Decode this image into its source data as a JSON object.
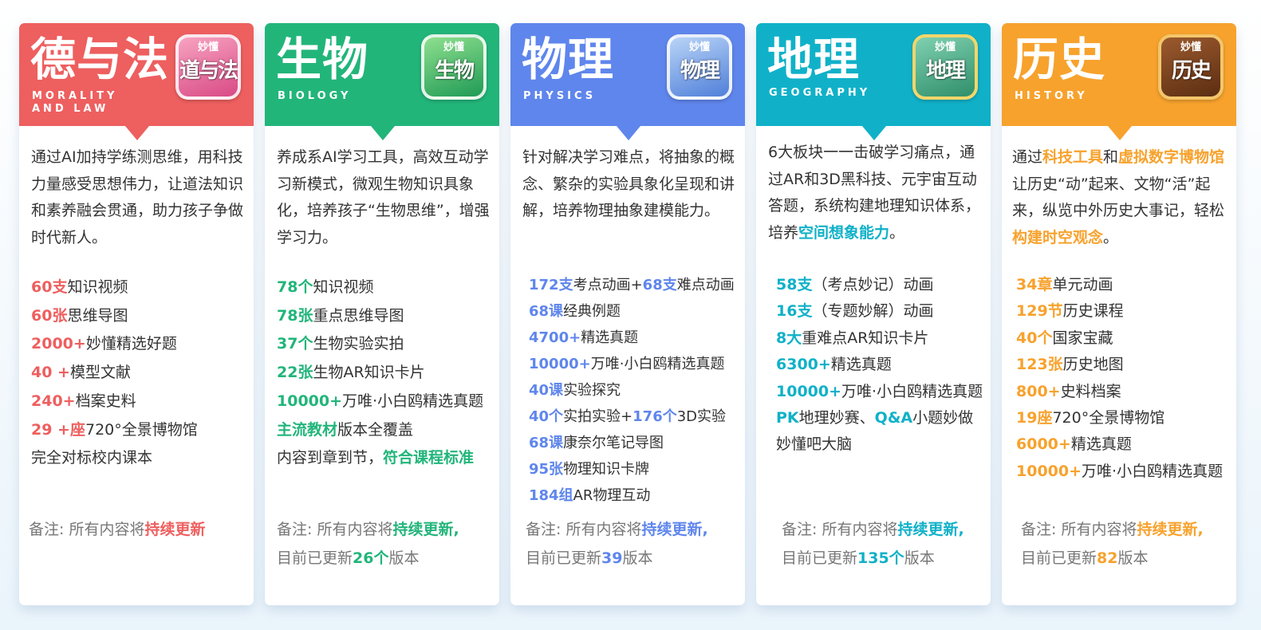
{
  "cards": [
    {
      "title": "德与法",
      "english_line1": "MORALITY",
      "english_line2": "AND LAW",
      "badge_brand": "妙懂",
      "badge_text": "道与法",
      "color": "#ee5f5f",
      "desc": [
        {
          "t": "通过AI加持学练测思维，用科技力量感受思想伟力，让道法知识和素养融会贯通，助力孩子争做时代新人。"
        }
      ],
      "items": [
        [
          {
            "t": "60支",
            "h": true
          },
          {
            "t": "知识视频"
          }
        ],
        [
          {
            "t": "60张",
            "h": true
          },
          {
            "t": "思维导图"
          }
        ],
        [
          {
            "t": "2000+",
            "h": true
          },
          {
            "t": "妙懂精选好题"
          }
        ],
        [
          {
            "t": "40 +",
            "h": true
          },
          {
            "t": "模型文献"
          }
        ],
        [
          {
            "t": "240+",
            "h": true
          },
          {
            "t": "档案史料"
          }
        ],
        [
          {
            "t": "29 +座",
            "h": true
          },
          {
            "t": "720°全景博物馆"
          }
        ],
        [
          {
            "t": "完全对标校内课本"
          }
        ]
      ],
      "note_line1": [
        {
          "t": "备注: 所有内容将"
        },
        {
          "t": "持续更新",
          "h": true
        }
      ],
      "note_line2": []
    },
    {
      "title": "生物",
      "english_line1": "BIOLOGY",
      "english_line2": "",
      "badge_brand": "妙懂",
      "badge_text": "生物",
      "color": "#22b57a",
      "desc": [
        {
          "t": "养成系AI学习工具，高效互动学习新模式，微观生物知识具象化，培养孩子“生物思维”，增强学习力。"
        }
      ],
      "items": [
        [
          {
            "t": "78个",
            "h": true
          },
          {
            "t": "知识视频"
          }
        ],
        [
          {
            "t": "78张",
            "h": true
          },
          {
            "t": "重点思维导图"
          }
        ],
        [
          {
            "t": "37个",
            "h": true
          },
          {
            "t": "生物实验实拍"
          }
        ],
        [
          {
            "t": "22张",
            "h": true
          },
          {
            "t": "生物AR知识卡片"
          }
        ],
        [
          {
            "t": "10000+",
            "h": true
          },
          {
            "t": "万唯·小白鸥精选真题"
          }
        ],
        [
          {
            "t": "主流教材",
            "h": true
          },
          {
            "t": "版本全覆盖"
          }
        ],
        [
          {
            "t": "内容到章到节，"
          },
          {
            "t": "符合课程标准",
            "h": true
          }
        ]
      ],
      "note_line1": [
        {
          "t": "备注: 所有内容将"
        },
        {
          "t": "持续更新,",
          "h": true
        }
      ],
      "note_line2": [
        {
          "t": "目前已更新"
        },
        {
          "t": "26个",
          "h": true
        },
        {
          "t": "版本"
        }
      ]
    },
    {
      "title": "物理",
      "english_line1": "PHYSICS",
      "english_line2": "",
      "badge_brand": "妙懂",
      "badge_text": "物理",
      "color": "#5f86ec",
      "desc": [
        {
          "t": "针对解决学习难点，将抽象的概念、繁杂的实验具象化呈现和讲解，培养物理抽象建模能力。"
        }
      ],
      "items": [
        [
          {
            "t": "172支",
            "h": true
          },
          {
            "t": "考点动画+"
          },
          {
            "t": "68支",
            "h": true
          },
          {
            "t": "难点动画"
          }
        ],
        [
          {
            "t": "68课",
            "h": true
          },
          {
            "t": "经典例题"
          }
        ],
        [
          {
            "t": "4700+",
            "h": true
          },
          {
            "t": "精选真题"
          }
        ],
        [
          {
            "t": "10000+",
            "h": true
          },
          {
            "t": "万唯·小白鸥精选真题"
          }
        ],
        [
          {
            "t": "40课",
            "h": true
          },
          {
            "t": "实验探究"
          }
        ],
        [
          {
            "t": "40个",
            "h": true
          },
          {
            "t": "实拍实验+"
          },
          {
            "t": "176个",
            "h": true
          },
          {
            "t": "3D实验"
          }
        ],
        [
          {
            "t": "68课",
            "h": true
          },
          {
            "t": "康奈尔笔记导图"
          }
        ],
        [
          {
            "t": "95张",
            "h": true
          },
          {
            "t": "物理知识卡牌"
          }
        ],
        [
          {
            "t": "184组",
            "h": true
          },
          {
            "t": "AR物理互动"
          }
        ]
      ],
      "note_line1": [
        {
          "t": "备注: 所有内容将"
        },
        {
          "t": "持续更新,",
          "h": true
        }
      ],
      "note_line2": [
        {
          "t": "目前已更新"
        },
        {
          "t": "39",
          "h": true
        },
        {
          "t": "版本"
        }
      ]
    },
    {
      "title": "地理",
      "english_line1": "GEOGRAPHY",
      "english_line2": "",
      "badge_brand": "妙懂",
      "badge_text": "地理",
      "color": "#10b1c8",
      "desc": [
        {
          "t": "6大板块一一击破学习痛点，通过AR和3D黑科技、元宇宙互动答题，系统构建地理知识体系，培养"
        },
        {
          "t": "空间想象能力",
          "h": true
        },
        {
          "t": "。"
        }
      ],
      "items": [
        [
          {
            "t": "58支",
            "h": true
          },
          {
            "t": "（考点妙记）动画"
          }
        ],
        [
          {
            "t": "16支",
            "h": true
          },
          {
            "t": "（专题妙解）动画"
          }
        ],
        [
          {
            "t": "8大",
            "h": true
          },
          {
            "t": "重难点AR知识卡片"
          }
        ],
        [
          {
            "t": "6300+",
            "h": true
          },
          {
            "t": "精选真题"
          }
        ],
        [
          {
            "t": "10000+",
            "h": true
          },
          {
            "t": "万唯·小白鸥精选真题"
          }
        ],
        [
          {
            "t": "PK",
            "h": true
          },
          {
            "t": "地理妙赛、"
          },
          {
            "t": "Q&A",
            "h": true
          },
          {
            "t": "小题妙做"
          }
        ],
        [
          {
            "t": " 妙懂吧大脑"
          }
        ]
      ],
      "note_line1": [
        {
          "t": "备注: 所有内容将"
        },
        {
          "t": "持续更新,",
          "h": true
        }
      ],
      "note_line2": [
        {
          "t": "目前已更新"
        },
        {
          "t": "135个",
          "h": true
        },
        {
          "t": "版本"
        }
      ]
    },
    {
      "title": "历史",
      "english_line1": "HISTORY",
      "english_line2": "",
      "badge_brand": "妙懂",
      "badge_text": "历史",
      "color": "#f7a22d",
      "desc": [
        {
          "t": "通过"
        },
        {
          "t": "科技工具",
          "h": true
        },
        {
          "t": "和"
        },
        {
          "t": "虚拟数字博物馆",
          "h": true
        },
        {
          "t": "让历史“动”起来、文物“活”起来，纵览中外历史大事记，轻松"
        },
        {
          "t": "构建时空观念",
          "h": true
        },
        {
          "t": "。"
        }
      ],
      "items": [
        [
          {
            "t": "34章",
            "h": true
          },
          {
            "t": "单元动画"
          }
        ],
        [
          {
            "t": "129节",
            "h": true
          },
          {
            "t": "历史课程"
          }
        ],
        [
          {
            "t": "40个",
            "h": true
          },
          {
            "t": "国家宝藏"
          }
        ],
        [
          {
            "t": "123张",
            "h": true
          },
          {
            "t": "历史地图"
          }
        ],
        [
          {
            "t": "800+",
            "h": true
          },
          {
            "t": "史料档案"
          }
        ],
        [
          {
            "t": "19座",
            "h": true
          },
          {
            "t": "720°全景博物馆"
          }
        ],
        [
          {
            "t": "6000+",
            "h": true
          },
          {
            "t": "精选真题"
          }
        ],
        [
          {
            "t": "10000+",
            "h": true
          },
          {
            "t": "万唯·小白鸥精选真题"
          }
        ]
      ],
      "note_line1": [
        {
          "t": "备注: 所有内容将"
        },
        {
          "t": "持续更新,",
          "h": true
        }
      ],
      "note_line2": [
        {
          "t": "目前已更新"
        },
        {
          "t": "82",
          "h": true
        },
        {
          "t": "版本"
        }
      ]
    }
  ]
}
